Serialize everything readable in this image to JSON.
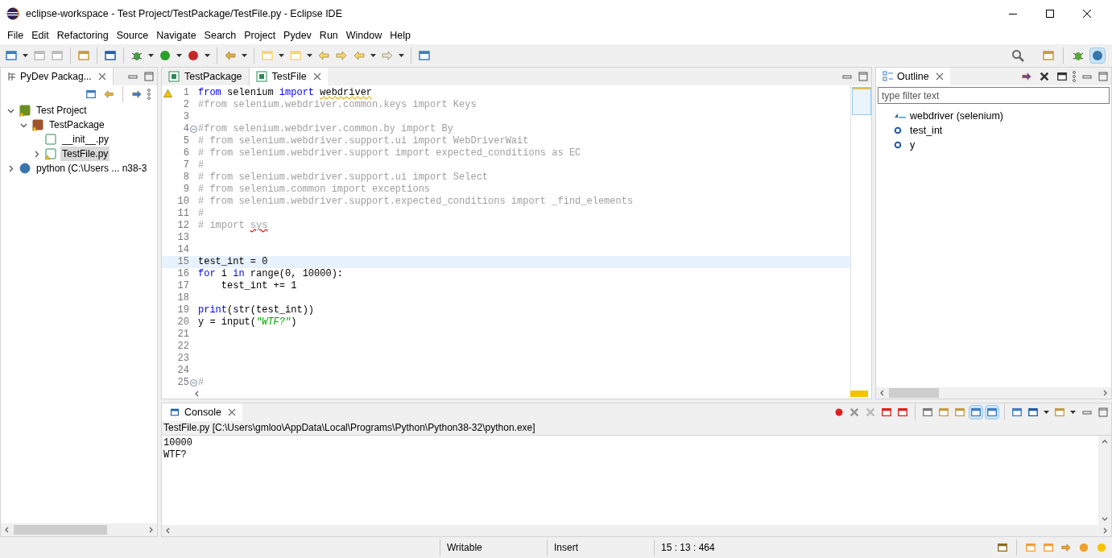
{
  "window": {
    "title": "eclipse-workspace - Test Project/TestPackage/TestFile.py - Eclipse IDE"
  },
  "menu": [
    "File",
    "Edit",
    "Refactoring",
    "Source",
    "Navigate",
    "Search",
    "Project",
    "Pydev",
    "Run",
    "Window",
    "Help"
  ],
  "explorer": {
    "title": "PyDev Packag...",
    "tree": [
      {
        "label": "Test Project",
        "kind": "project",
        "expanded": true,
        "selected": false,
        "children": [
          {
            "label": "TestPackage",
            "kind": "package",
            "expanded": true,
            "selected": false,
            "children": [
              {
                "label": "__init__.py",
                "kind": "module",
                "selected": false
              },
              {
                "label": "TestFile.py",
                "kind": "file",
                "expanded": false,
                "selected": true
              }
            ]
          }
        ]
      },
      {
        "label": "python  (C:\\Users ... n38-3",
        "kind": "interpreter",
        "expanded": false,
        "selected": false
      }
    ]
  },
  "editor": {
    "tabs": [
      {
        "label": "TestPackage",
        "selected": false
      },
      {
        "label": "TestFile",
        "selected": true
      }
    ],
    "lines": [
      {
        "num": "1",
        "current": false,
        "warning": true,
        "fold": false,
        "segments": [
          {
            "kind": "keyword",
            "text": "from"
          },
          {
            "kind": "plain",
            "text": " selenium "
          },
          {
            "kind": "keyword",
            "text": "import "
          },
          {
            "kind": "warn_name",
            "text": "webdriver"
          }
        ]
      },
      {
        "num": "2",
        "current": false,
        "warning": false,
        "fold": false,
        "segments": [
          {
            "kind": "comment",
            "text": "#from selenium.webdriver.common.keys import Keys"
          }
        ]
      },
      {
        "num": "3",
        "current": false,
        "warning": false,
        "fold": false
      },
      {
        "num": "4",
        "current": false,
        "warning": false,
        "fold": true,
        "segments": [
          {
            "kind": "comment",
            "text": "#from selenium.webdriver.common.by import By"
          }
        ]
      },
      {
        "num": "5",
        "current": false,
        "warning": false,
        "fold": false,
        "segments": [
          {
            "kind": "comment",
            "text": "# from selenium.webdriver.support.ui import WebDriverWait"
          }
        ]
      },
      {
        "num": "6",
        "current": false,
        "warning": false,
        "fold": false,
        "segments": [
          {
            "kind": "comment",
            "text": "# from selenium.webdriver.support import expected_conditions as EC"
          }
        ]
      },
      {
        "num": "7",
        "current": false,
        "warning": false,
        "fold": false,
        "segments": [
          {
            "kind": "comment",
            "text": "#"
          }
        ]
      },
      {
        "num": "8",
        "current": false,
        "warning": false,
        "fold": false,
        "segments": [
          {
            "kind": "comment",
            "text": "# from selenium.webdriver.support.ui import Select"
          }
        ]
      },
      {
        "num": "9",
        "current": false,
        "warning": false,
        "fold": false,
        "segments": [
          {
            "kind": "comment",
            "text": "# from selenium.common import exceptions"
          }
        ]
      },
      {
        "num": "10",
        "current": false,
        "warning": false,
        "fold": false,
        "segments": [
          {
            "kind": "comment",
            "text": "# from selenium.webdriver.support.expected_conditions import _find_elements"
          }
        ]
      },
      {
        "num": "11",
        "current": false,
        "warning": false,
        "fold": false,
        "segments": [
          {
            "kind": "comment",
            "text": "#"
          }
        ]
      },
      {
        "num": "12",
        "current": false,
        "warning": false,
        "fold": false,
        "segments": [
          {
            "kind": "comment",
            "text": "# import "
          },
          {
            "kind": "error_comment",
            "text": "sys"
          }
        ]
      },
      {
        "num": "13",
        "current": false,
        "warning": false,
        "fold": false
      },
      {
        "num": "14",
        "current": false,
        "warning": false,
        "fold": false
      },
      {
        "num": "15",
        "current": true,
        "warning": false,
        "fold": false,
        "segments": [
          {
            "kind": "plain",
            "text": "test_int = 0"
          }
        ]
      },
      {
        "num": "16",
        "current": false,
        "warning": false,
        "fold": false,
        "segments": [
          {
            "kind": "keyword",
            "text": "for"
          },
          {
            "kind": "plain",
            "text": " i "
          },
          {
            "kind": "keyword",
            "text": "in"
          },
          {
            "kind": "plain",
            "text": " range(0, 10000):"
          }
        ]
      },
      {
        "num": "17",
        "current": false,
        "warning": false,
        "fold": false,
        "segments": [
          {
            "kind": "plain",
            "text": "    test_int += 1"
          }
        ]
      },
      {
        "num": "18",
        "current": false,
        "warning": false,
        "fold": false
      },
      {
        "num": "19",
        "current": false,
        "warning": false,
        "fold": false,
        "segments": [
          {
            "kind": "keyword",
            "text": "print"
          },
          {
            "kind": "plain",
            "text": "(str(test_int))"
          }
        ]
      },
      {
        "num": "20",
        "current": false,
        "warning": false,
        "fold": false,
        "segments": [
          {
            "kind": "plain",
            "text": "y = input("
          },
          {
            "kind": "string",
            "text": "\"WTF?\""
          },
          {
            "kind": "plain",
            "text": ")"
          }
        ]
      },
      {
        "num": "21",
        "current": false,
        "warning": false,
        "fold": false
      },
      {
        "num": "22",
        "current": false,
        "warning": false,
        "fold": false
      },
      {
        "num": "23",
        "current": false,
        "warning": false,
        "fold": false
      },
      {
        "num": "24",
        "current": false,
        "warning": false,
        "fold": false
      },
      {
        "num": "25",
        "current": false,
        "warning": false,
        "fold": true,
        "segments": [
          {
            "kind": "comment",
            "text": "#"
          }
        ]
      }
    ]
  },
  "outline": {
    "title": "Outline",
    "filter": {
      "placeholder": "type filter text"
    },
    "items": [
      {
        "label": "webdriver (selenium)",
        "kind": "import"
      },
      {
        "label": "test_int",
        "kind": "variable"
      },
      {
        "label": "y",
        "kind": "variable"
      }
    ]
  },
  "console": {
    "title": "Console",
    "description": "TestFile.py [C:\\Users\\gmloo\\AppData\\Local\\Programs\\Python\\Python38-32\\python.exe]",
    "output": [
      "10000",
      "WTF?"
    ]
  },
  "status_bar": [
    "Writable",
    "Insert",
    "15 : 13 : 464"
  ]
}
